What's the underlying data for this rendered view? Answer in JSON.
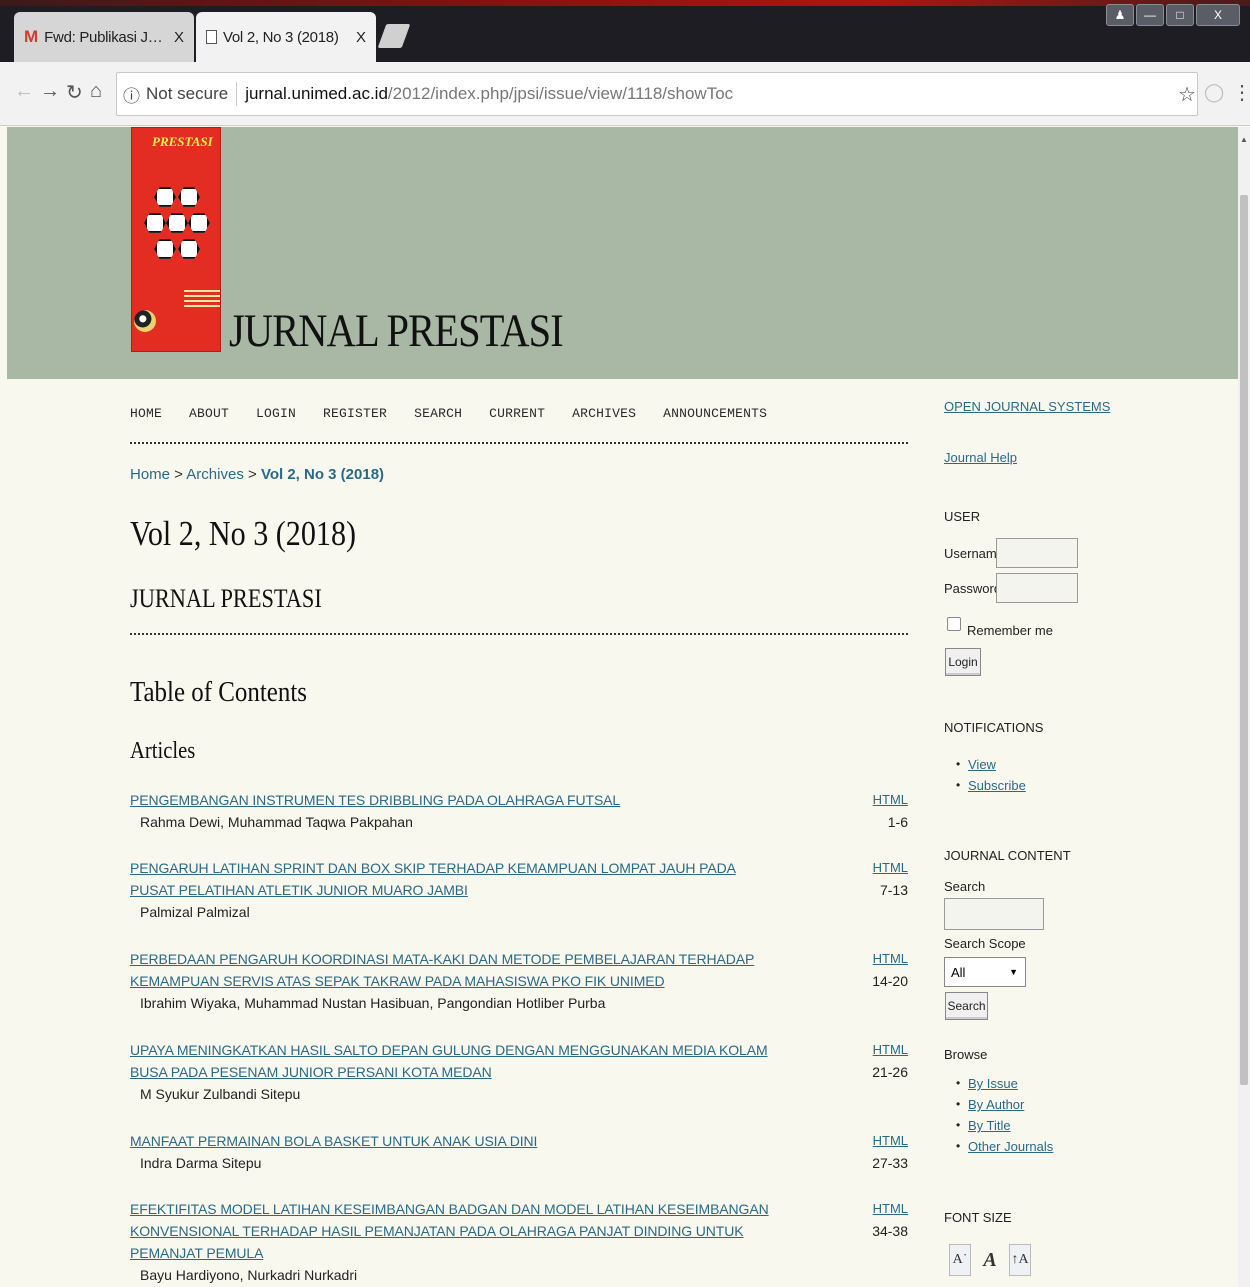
{
  "browser": {
    "tabs": [
      {
        "label": "Fwd: Publikasi Jurnal Prestasi",
        "icon": "gmail-icon"
      },
      {
        "label": "Vol 2, No 3 (2018)",
        "icon": "document-icon"
      }
    ],
    "tab_close": "X",
    "address": {
      "security": "Not secure",
      "host": "jurnal.unimed.ac.id",
      "path": "/2012/index.php/jpsi/issue/view/1118/showToc"
    },
    "window_close": "X"
  },
  "header": {
    "journal_title": "JURNAL PRESTASI",
    "cover_title": "PRESTASI"
  },
  "nav": {
    "items": [
      "HOME",
      "ABOUT",
      "LOGIN",
      "REGISTER",
      "SEARCH",
      "CURRENT",
      "ARCHIVES",
      "ANNOUNCEMENTS"
    ]
  },
  "breadcrumb": {
    "home": "Home",
    "sep": " > ",
    "archives": "Archives",
    "current": "Vol 2, No 3 (2018)"
  },
  "main": {
    "issue_title": "Vol 2, No 3 (2018)",
    "journal_subtitle": "JURNAL PRESTASI",
    "toc_heading": "Table of Contents",
    "section_heading": "Articles",
    "articles": [
      {
        "title": "PENGEMBANGAN INSTRUMEN TES DRIBBLING PADA OLAHRAGA FUTSAL",
        "authors": "Rahma Dewi, Muhammad Taqwa Pakpahan",
        "galley": "HTML",
        "pages": "1-6"
      },
      {
        "title": "PENGARUH LATIHAN SPRINT DAN BOX SKIP TERHADAP KEMAMPUAN LOMPAT JAUH PADA PUSAT PELATIHAN ATLETIK JUNIOR MUARO JAMBI",
        "authors": "Palmizal Palmizal",
        "galley": "HTML",
        "pages": "7-13"
      },
      {
        "title": "PERBEDAAN PENGARUH KOORDINASI MATA-KAKI DAN METODE PEMBELAJARAN TERHADAP KEMAMPUAN SERVIS ATAS SEPAK TAKRAW PADA MAHASISWA PKO FIK UNIMED",
        "authors": "Ibrahim Wiyaka, Muhammad Nustan Hasibuan, Pangondian Hotliber Purba",
        "galley": "HTML",
        "pages": "14-20"
      },
      {
        "title": "UPAYA MENINGKATKAN HASIL SALTO DEPAN GULUNG DENGAN MENGGUNAKAN MEDIA KOLAM BUSA PADA PESENAM JUNIOR PERSANI KOTA MEDAN",
        "authors": "M Syukur Zulbandi Sitepu",
        "galley": "HTML",
        "pages": "21-26"
      },
      {
        "title": "MANFAAT PERMAINAN BOLA BASKET UNTUK ANAK USIA DINI",
        "authors": "Indra Darma Sitepu",
        "galley": "HTML",
        "pages": "27-33"
      },
      {
        "title": "EFEKTIFITAS MODEL LATIHAN KESEIMBANGAN BADGAN DAN MODEL LATIHAN KESEIMBANGAN KONVENSIONAL TERHADAP HASIL PEMANJATAN PADA OLAHRAGA PANJAT DINDING UNTUK PEMANJAT PEMULA",
        "authors": "Bayu Hardiyono, Nurkadri Nurkadri",
        "galley": "HTML",
        "pages": "34-38"
      }
    ]
  },
  "sidebar": {
    "ojs_link": "OPEN JOURNAL SYSTEMS",
    "help_link": "Journal Help",
    "user_title": "USER",
    "username_label": "Username",
    "password_label": "Password",
    "remember_label": "Remember me",
    "login_button": "Login",
    "notifications_title": "NOTIFICATIONS",
    "notifications": [
      "View",
      "Subscribe"
    ],
    "content_title": "JOURNAL CONTENT",
    "search_label": "Search",
    "scope_label": "Search Scope",
    "scope_value": "All",
    "search_button": "Search",
    "browse_label": "Browse",
    "browse_links": [
      "By Issue",
      "By Author",
      "By Title",
      "Other Journals"
    ],
    "font_title": "FONT SIZE"
  }
}
